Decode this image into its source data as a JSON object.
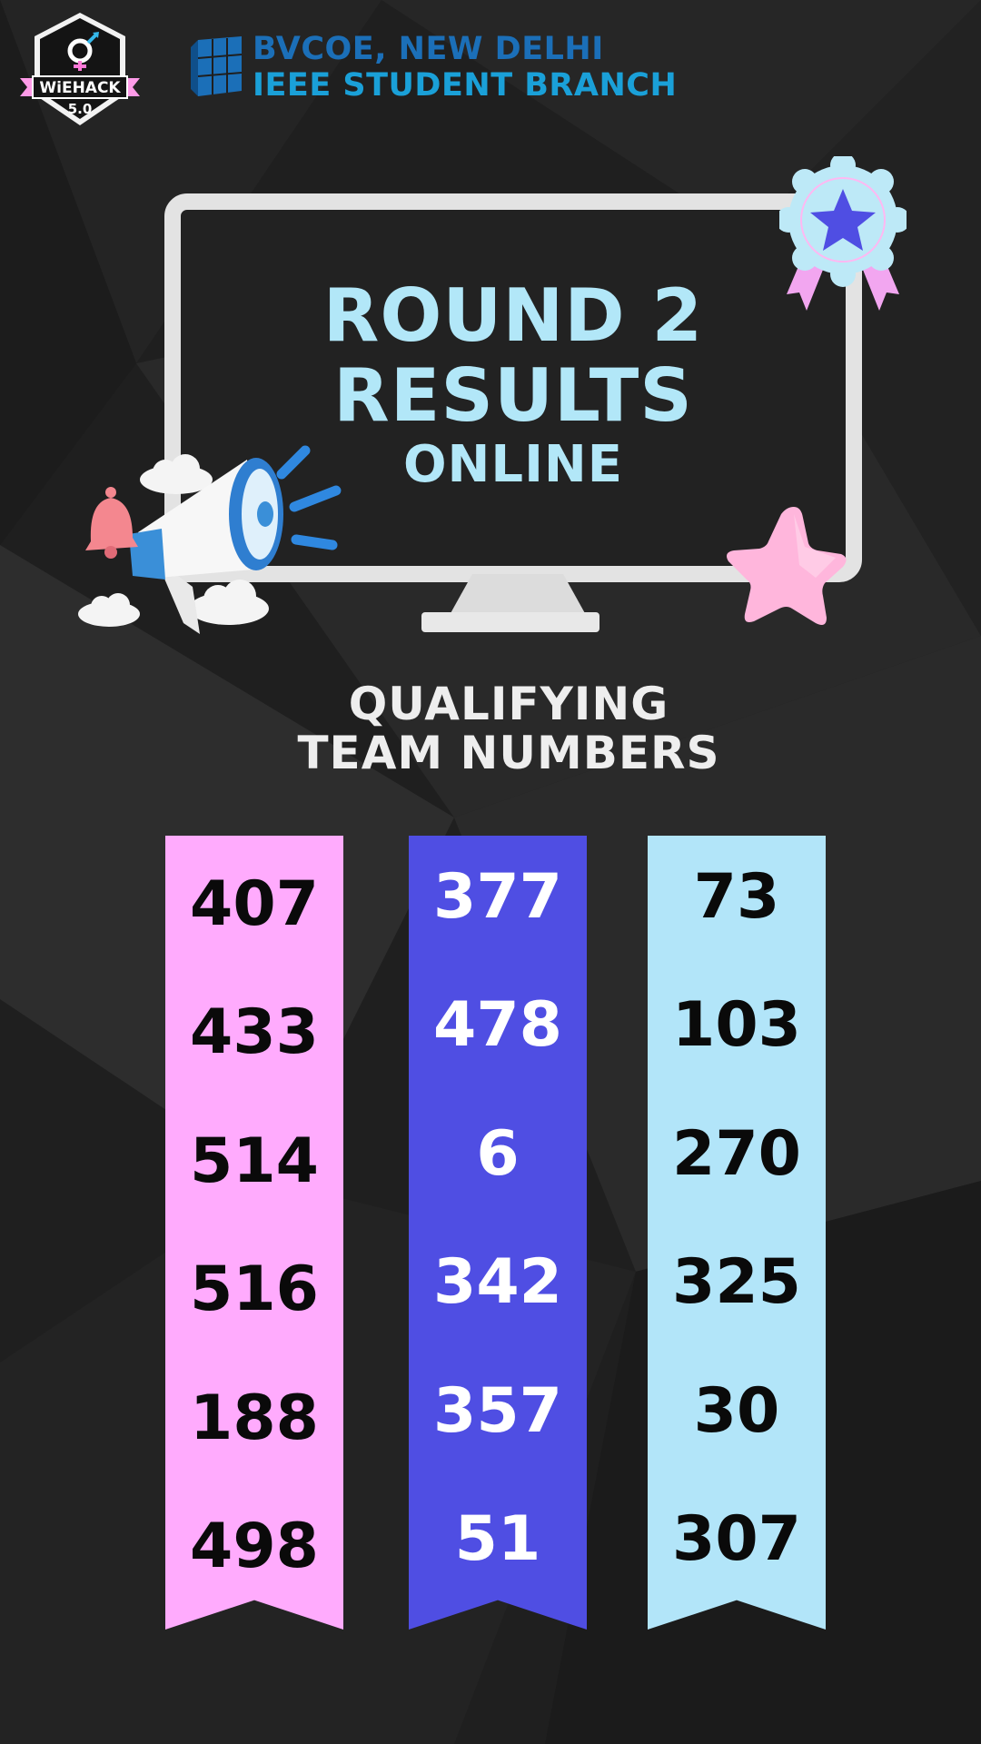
{
  "header": {
    "badge": {
      "name": "WiEHACK",
      "version": "5.0",
      "icon": "gender-gear-icon"
    },
    "org_line1": "BVCOE, NEW DELHI",
    "org_line2": "IEEE STUDENT BRANCH",
    "org_icon": "ieee-cube-icon"
  },
  "headline": {
    "line1": "ROUND 2",
    "line2": "RESULTS",
    "line3": "ONLINE"
  },
  "subheading": {
    "line1": "QUALIFYING",
    "line2": "TEAM NUMBERS"
  },
  "team_columns": [
    {
      "color": "#ffabfd",
      "teams": [
        "407",
        "433",
        "514",
        "516",
        "188",
        "498"
      ]
    },
    {
      "color": "#4f4ee3",
      "teams": [
        "377",
        "478",
        "6",
        "342",
        "357",
        "51"
      ]
    },
    {
      "color": "#b2e5f9",
      "teams": [
        "73",
        "103",
        "270",
        "325",
        "30",
        "307"
      ]
    }
  ],
  "colors": {
    "background": "#1f1f1f",
    "headline": "#b2e7f8",
    "org_dark_blue": "#1b6fb8",
    "org_light_blue": "#1aa0d8"
  }
}
